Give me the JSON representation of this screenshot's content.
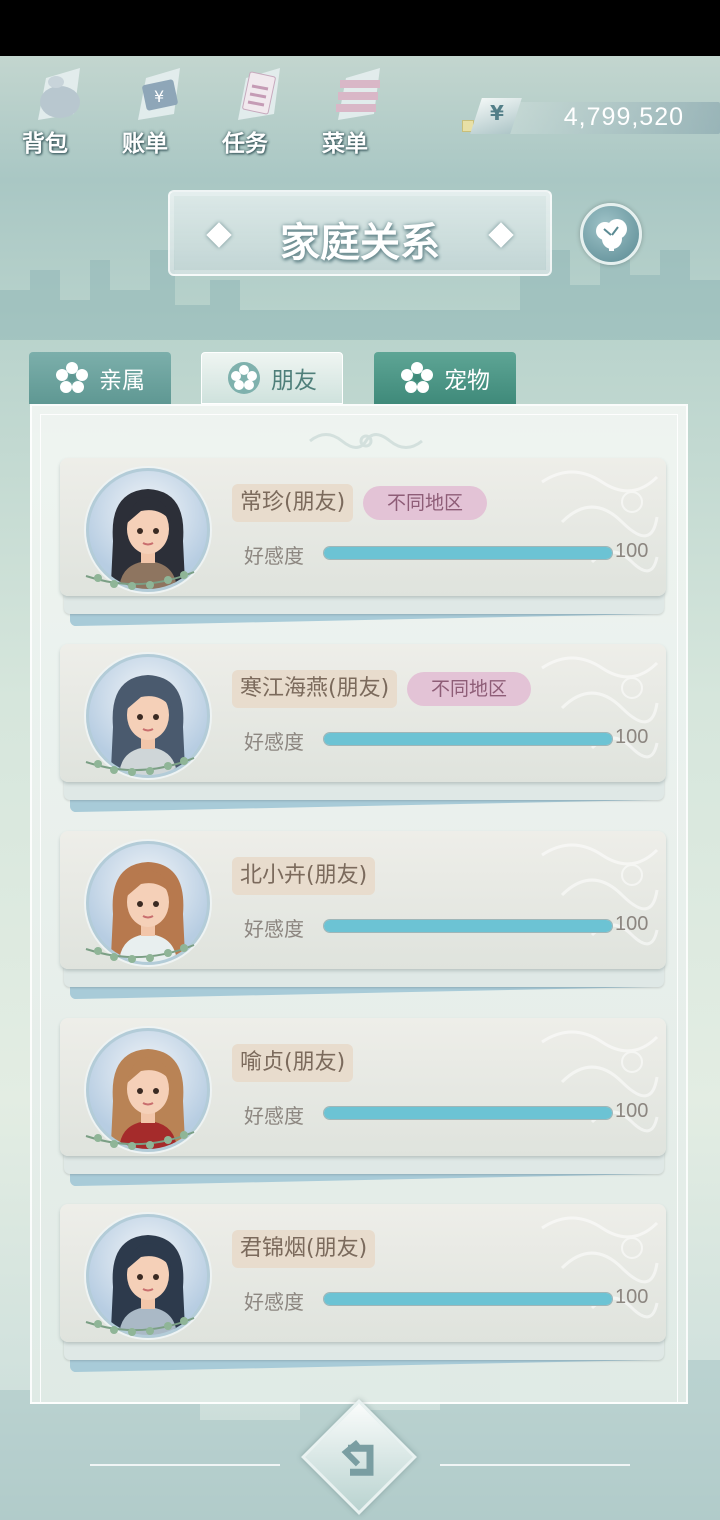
{
  "top_nav": [
    {
      "label": "背包",
      "icon": "backpack-icon"
    },
    {
      "label": "账单",
      "icon": "bill-icon"
    },
    {
      "label": "任务",
      "icon": "task-icon"
    },
    {
      "label": "菜单",
      "icon": "menu-icon"
    }
  ],
  "currency": {
    "symbol": "¥",
    "amount": "4,799,520"
  },
  "header": {
    "title": "家庭关系",
    "tree_icon": "family-tree-icon"
  },
  "tabs": [
    {
      "label": "亲属",
      "active": false
    },
    {
      "label": "朋友",
      "active": true
    },
    {
      "label": "宠物",
      "active": false
    }
  ],
  "favor_label": "好感度",
  "friends": [
    {
      "name": "常珍(朋友)",
      "region": "不同地区",
      "favor": 100,
      "favor_text": "100"
    },
    {
      "name": "寒江海燕(朋友)",
      "region": "不同地区",
      "favor": 100,
      "favor_text": "100"
    },
    {
      "name": "北小卉(朋友)",
      "region": "",
      "favor": 100,
      "favor_text": "100"
    },
    {
      "name": "喻贞(朋友)",
      "region": "",
      "favor": 100,
      "favor_text": "100"
    },
    {
      "name": "君锦烟(朋友)",
      "region": "",
      "favor": 100,
      "favor_text": "100"
    }
  ],
  "colors": {
    "favor_fill": "#6cc3d4",
    "region_bg": "#e3c3d6",
    "name_bg": "#e8dccd"
  },
  "back_button": {
    "icon": "back-arrow-icon"
  }
}
